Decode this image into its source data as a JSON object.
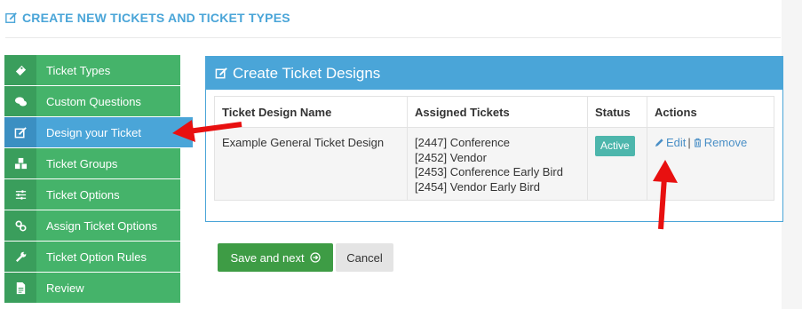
{
  "page": {
    "title": "CREATE NEW TICKETS AND TICKET TYPES",
    "title_icon": "edit-icon",
    "accent_color": "#4aa5d8",
    "sidebar_color": "#45b36a"
  },
  "sidebar": {
    "items": [
      {
        "label": "Ticket Types",
        "icon": "ticket-icon",
        "active": false
      },
      {
        "label": "Custom Questions",
        "icon": "comments-icon",
        "active": false
      },
      {
        "label": "Design your Ticket",
        "icon": "edit-icon",
        "active": true
      },
      {
        "label": "Ticket Groups",
        "icon": "cubes-icon",
        "active": false
      },
      {
        "label": "Ticket Options",
        "icon": "sliders-icon",
        "active": false
      },
      {
        "label": "Assign Ticket Options",
        "icon": "link-icon",
        "active": false
      },
      {
        "label": "Ticket Option Rules",
        "icon": "wrench-icon",
        "active": false
      },
      {
        "label": "Review",
        "icon": "file-icon",
        "active": false
      }
    ]
  },
  "panel": {
    "title": "Create Ticket Designs",
    "columns": [
      "Ticket Design Name",
      "Assigned Tickets",
      "Status",
      "Actions"
    ],
    "rows": [
      {
        "name": "Example General Ticket Design",
        "tickets": [
          "[2447] Conference",
          "[2452] Vendor",
          "[2453] Conference Early Bird",
          "[2454] Vendor Early Bird"
        ],
        "status": "Active",
        "edit_label": "Edit",
        "separator": "|",
        "remove_label": "Remove"
      }
    ]
  },
  "buttons": {
    "save_label": "Save and next",
    "cancel_label": "Cancel"
  }
}
